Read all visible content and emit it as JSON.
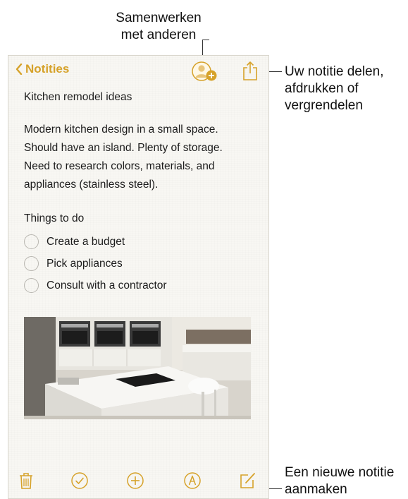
{
  "callouts": {
    "collaborate": [
      "Samenwerken",
      "met anderen"
    ],
    "share": [
      "Uw notitie delen,",
      "afdrukken of",
      "vergrendelen"
    ],
    "new_note": [
      "Een nieuwe notitie",
      "aanmaken"
    ]
  },
  "nav": {
    "back_label": "Notities",
    "collaborate_icon": "add-person-icon",
    "share_icon": "share-icon"
  },
  "note": {
    "title": "Kitchen remodel ideas",
    "paragraph_lines": [
      "Modern kitchen design in a small space.",
      "Should have an island. Plenty of storage.",
      "Need to research colors, materials, and",
      "appliances (stainless steel)."
    ],
    "checklist_heading": "Things to do",
    "checklist": [
      {
        "label": "Create a budget",
        "checked": false
      },
      {
        "label": "Pick appliances",
        "checked": false
      },
      {
        "label": "Consult with a contractor",
        "checked": false
      }
    ]
  },
  "toolbar": {
    "icons": [
      "trash-icon",
      "checklist-icon",
      "add-icon",
      "markup-icon",
      "compose-icon"
    ]
  },
  "colors": {
    "accent": "#d6a22a",
    "paper": "#f8f7f3",
    "icon_gray": "#b8b6b0"
  }
}
